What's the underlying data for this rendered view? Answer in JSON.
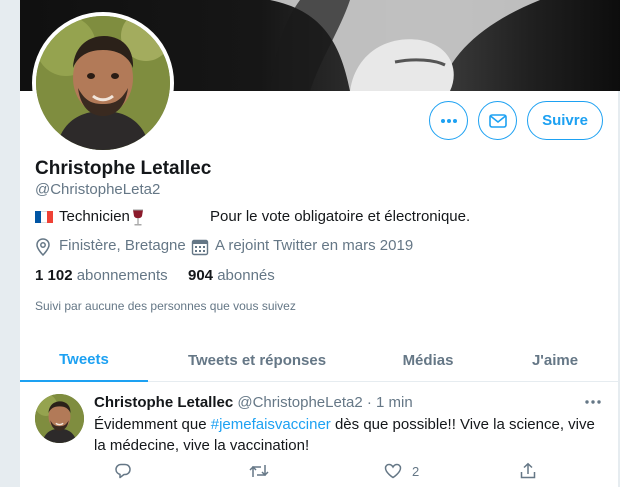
{
  "profile": {
    "name": "Christophe Letallec",
    "handle": "@ChristopheLeta2",
    "bio_job": "Technicien",
    "bio_text": "Pour le vote obligatoire et électronique.",
    "location": "Finistère, Bretagne",
    "joined": "A rejoint Twitter en mars 2019",
    "following_count": "1 102",
    "following_label": "abonnements",
    "followers_count": "904",
    "followers_label": "abonnés",
    "followed_by": "Suivi par aucune des personnes que vous suivez"
  },
  "actions": {
    "more_icon": "more-horizontal-icon",
    "message_icon": "mail-icon",
    "follow_label": "Suivre"
  },
  "tabs": [
    {
      "label": "Tweets",
      "active": true
    },
    {
      "label": "Tweets et réponses",
      "active": false
    },
    {
      "label": "Médias",
      "active": false
    },
    {
      "label": "J'aime",
      "active": false
    }
  ],
  "tweet": {
    "name": "Christophe Letallec",
    "handle": "@ChristopheLeta2",
    "dot": "·",
    "time": "1 min",
    "text_before": "Évidemment que ",
    "hashtag": "#jemefaisvacciner",
    "text_after": " dès que possible!! Vive la science, vive la médecine, vive la vaccination!",
    "reply_count": "",
    "retweet_count": "",
    "like_count": "2"
  },
  "colors": {
    "accent": "#1da1f2",
    "secondary_text": "#657786",
    "primary_text": "#14171a",
    "background": "#e6ecf0"
  }
}
